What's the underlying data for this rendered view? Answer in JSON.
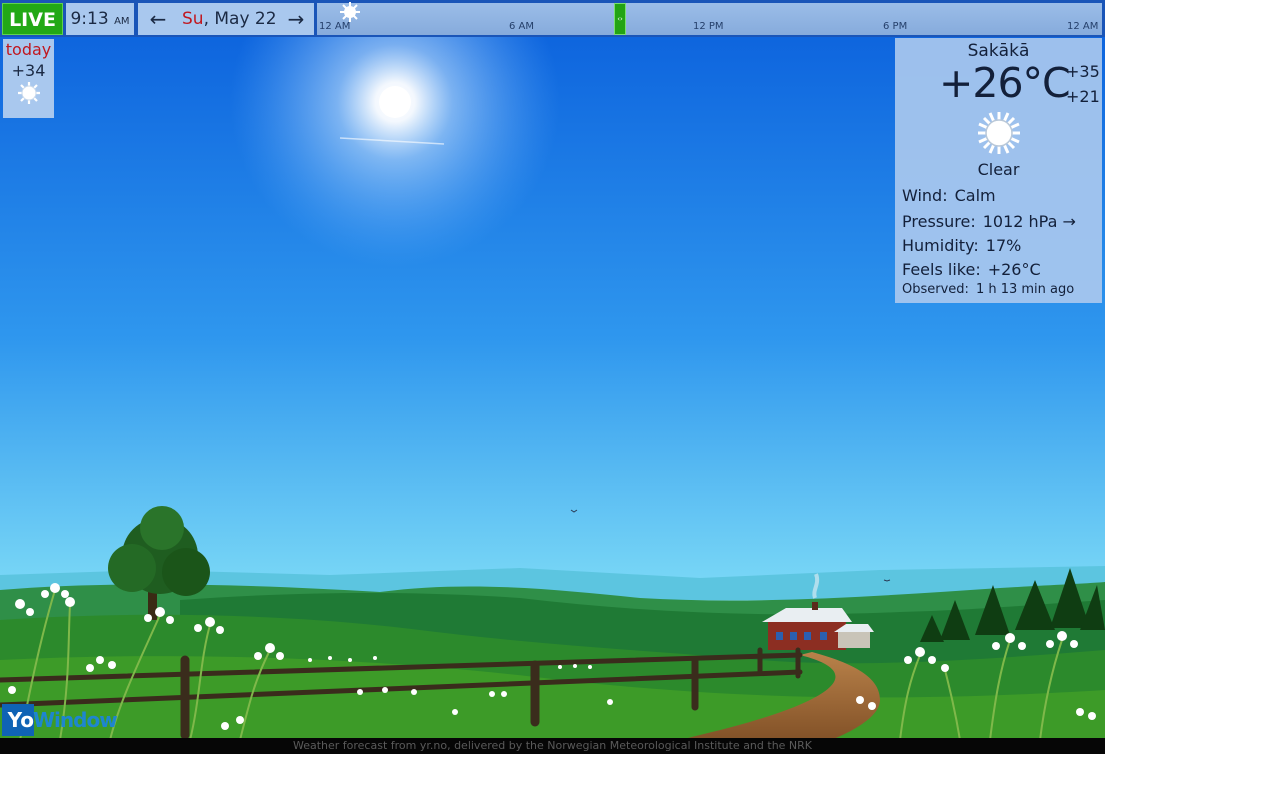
{
  "topbar": {
    "live_label": "LIVE",
    "time": "9:13",
    "time_ampm": "AM",
    "prev_arrow": "←",
    "next_arrow": "→",
    "date_dow": "Su",
    "date_rest": ", May 22",
    "timeline_ticks": [
      "12 AM",
      "6 AM",
      "12 PM",
      "6 PM",
      "12 AM"
    ],
    "timeline_marker": "‹›"
  },
  "today": {
    "label": "today",
    "temp": "+34",
    "icon": "sun-icon"
  },
  "panel": {
    "city": "Sakākā",
    "current_temp": "+26°C",
    "high": "+35",
    "low": "+21",
    "condition": "Clear",
    "condition_icon": "sun-icon",
    "wind_label": "Wind:",
    "wind_value": "Calm",
    "pressure_label": "Pressure:",
    "pressure_value": "1012 hPa →",
    "humidity_label": "Humidity:",
    "humidity_value": "17%",
    "feels_label": "Feels like:",
    "feels_value": "+26°C",
    "observed_label": "Observed:",
    "observed_value": "1 h 13 min ago"
  },
  "footer": {
    "logo_y": "Yo",
    "logo_rest": "Window",
    "credit": "Weather forecast from yr.no, delivered by the Norwegian Meteorological Institute and the NRK"
  },
  "colors": {
    "live_green": "#22a816",
    "panel_bg": "#a8c7ee",
    "sky_top": "#0a5fdc",
    "sky_bottom": "#7ad8f6",
    "accent_red": "#c0171f"
  }
}
